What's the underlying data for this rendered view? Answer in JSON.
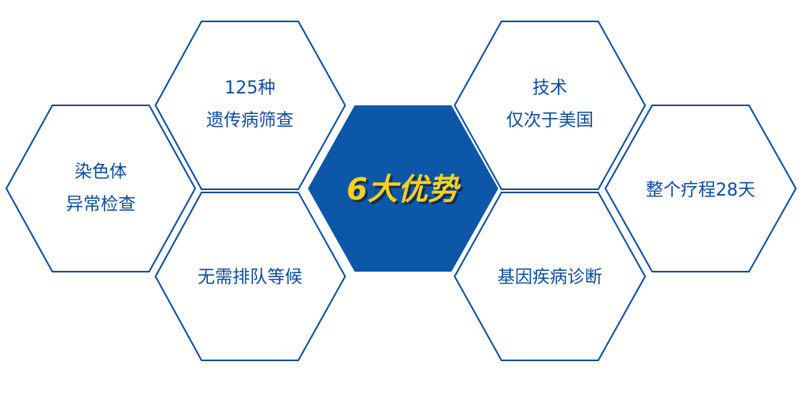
{
  "center": {
    "label": "6大优势"
  },
  "advantages": [
    {
      "lines": [
        "染色体",
        "异常检查"
      ]
    },
    {
      "lines": [
        "125种",
        "遗传病筛查"
      ]
    },
    {
      "lines": [
        "无需排队等候"
      ]
    },
    {
      "lines": [
        "技术",
        "仅次于美国"
      ]
    },
    {
      "lines": [
        "基因疾病诊断"
      ]
    },
    {
      "lines": [
        "整个疗程28天"
      ]
    }
  ],
  "colors": {
    "outline": "#0d4b9a",
    "text": "#0d4b9a",
    "center_fill": "#0d57a8",
    "center_text": "#ffd21a",
    "center_shadow": "#0a2e60"
  }
}
